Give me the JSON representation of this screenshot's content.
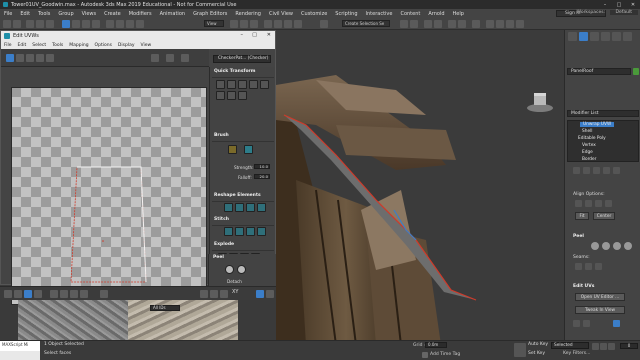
{
  "app": {
    "title": "Tower01UV_Goodwin.max - Autodesk 3ds Max 2019 Educational - Not for Commercial Use",
    "menu": [
      "File",
      "Edit",
      "Tools",
      "Group",
      "Views",
      "Create",
      "Modifiers",
      "Animation",
      "Graph Editors",
      "Rendering",
      "Civil View",
      "Customize",
      "Scripting",
      "Interactive",
      "Content",
      "Arnold",
      "Help"
    ],
    "sign_in": "Sign In",
    "workspaces_label": "Workspaces:",
    "workspace_value": "Default",
    "view_dropdown": "View",
    "selection_set": "Create Selection Se"
  },
  "uvw_window": {
    "title": "Edit UVWs",
    "menu": [
      "File",
      "Edit",
      "Select",
      "Tools",
      "Mapping",
      "Options",
      "Display",
      "View"
    ],
    "checker_dropdown": "CheckerPat... (Checker)",
    "rollouts": {
      "quick_transform": "Quick Transform",
      "brush": "Brush",
      "strength_label": "Strength:",
      "strength_value": "10.0",
      "falloff_label": "Falloff:",
      "falloff_value": "20.0",
      "reshape": "Reshape Elements",
      "stitch": "Stitch",
      "explode": "Explode",
      "weld_label": "Weld",
      "threshold_label": "Threshold:",
      "threshold_value": "0.0",
      "peel": "Peel",
      "detach_label": "Detach"
    },
    "xy_label": "XY",
    "all_ids": "All IDs"
  },
  "command_panel": {
    "object_name": "PanelRoof",
    "modifier_list": "Modifier List",
    "stack": [
      "Unwrap UVW",
      "Shell",
      "Editable Poly",
      "Vertex",
      "Edge",
      "Border"
    ],
    "align_options": "Align Options:",
    "fit_label": "Fit",
    "center_label": "Center",
    "peel_head": "Peel",
    "seams_label": "Seams:",
    "edit_uvs_head": "Edit UVs",
    "open_uv_editor": "Open UV Editor ...",
    "tweak_in_view": "Tweak In View"
  },
  "status": {
    "maxscript": "MAXScript Mi",
    "line1": "1 Object Selected",
    "line2": "Select faces",
    "grid_label": "Grid =",
    "grid_value": "0.0m",
    "add_time_tag": "Add Time Tag",
    "auto_key": "Auto Key",
    "set_key": "Set Key",
    "selected": "Selected",
    "key_filters": "Key Filters...",
    "frame": "0"
  },
  "colors": {
    "accent_blue": "#3b7ec9",
    "uv_edge_red": "#d03a2a",
    "uv_edge_white": "#f2f2f2",
    "viewport_bg": "#3c3c3c"
  }
}
